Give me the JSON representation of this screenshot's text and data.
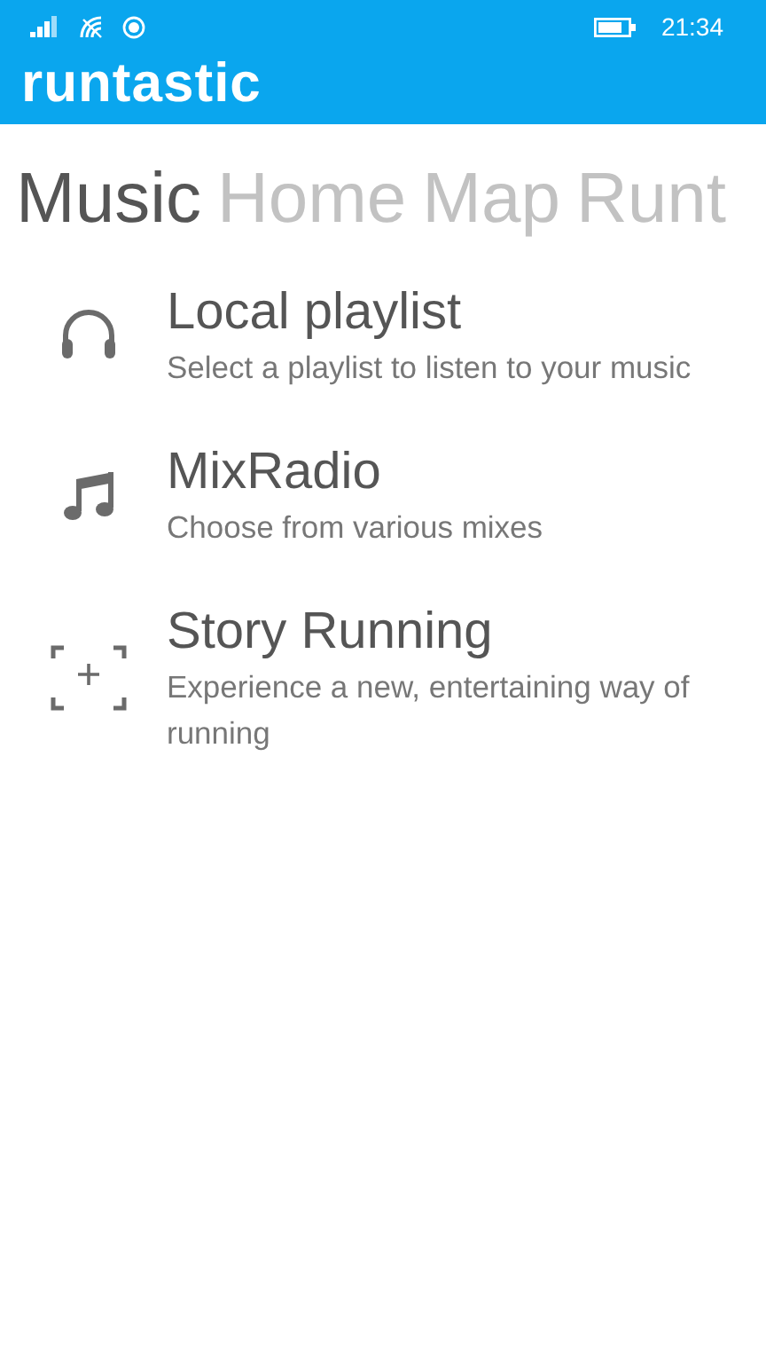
{
  "status_bar": {
    "time": "21:34"
  },
  "app_bar": {
    "logo": "runtastic"
  },
  "pivot": [
    {
      "label": "Music",
      "selected": true
    },
    {
      "label": "Home",
      "selected": false
    },
    {
      "label": "Map",
      "selected": false
    },
    {
      "label": "Runt",
      "selected": false
    }
  ],
  "items": [
    {
      "kind": "headphones",
      "title": "Local playlist",
      "subtitle": "Select a playlist to listen to your music"
    },
    {
      "kind": "note",
      "title": "MixRadio",
      "subtitle": "Choose from various mixes"
    },
    {
      "kind": "story",
      "title": "Story Running",
      "subtitle": "Experience a new, entertaining way of running"
    }
  ]
}
